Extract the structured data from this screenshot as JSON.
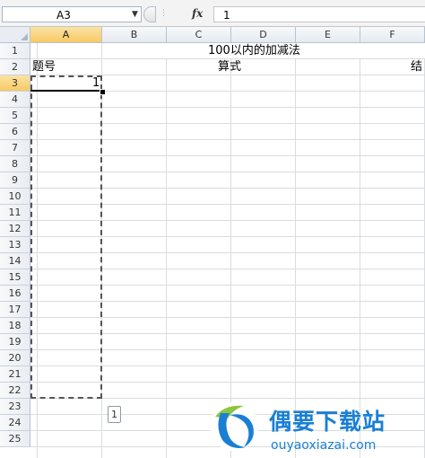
{
  "formula_bar": {
    "name_box": "A3",
    "fx_label": "fx",
    "formula": "1"
  },
  "columns": [
    "A",
    "B",
    "C",
    "D",
    "E",
    "F"
  ],
  "rows": [
    "1",
    "2",
    "3",
    "4",
    "5",
    "6",
    "7",
    "8",
    "9",
    "10",
    "11",
    "12",
    "13",
    "14",
    "15",
    "16",
    "17",
    "18",
    "19",
    "20",
    "21",
    "22",
    "23",
    "24",
    "25"
  ],
  "cells": {
    "title": "100以内的加减法",
    "a2": "题号",
    "c2": "算式",
    "f2": "结",
    "a3": "1"
  },
  "autofill_options_label": "1",
  "watermark": {
    "title": "偶要下载站",
    "url": "ouyaoxiazai.com",
    "color": "#1a7fd4"
  }
}
